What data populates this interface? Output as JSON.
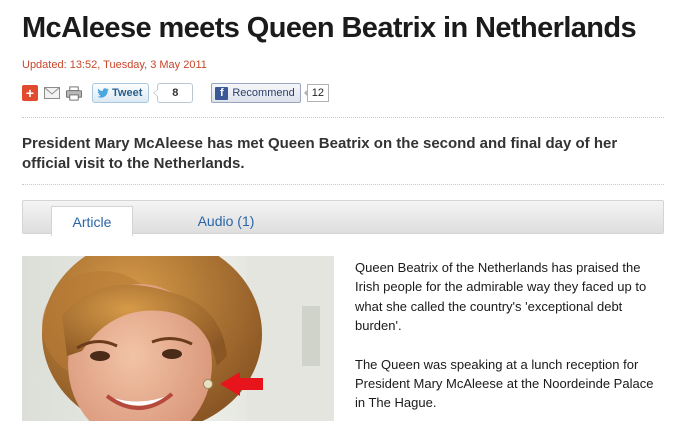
{
  "article": {
    "headline": "McAleese meets Queen Beatrix in Netherlands",
    "updated": "Updated: 13:52, Tuesday, 3 May 2011",
    "standfirst": "President Mary McAleese has met Queen Beatrix on the second and final day of her official visit to the Netherlands.",
    "paragraphs": [
      "Queen Beatrix of the Netherlands has praised the Irish people for the admirable way they faced up to what she called the country's 'exceptional debt burden'.",
      "The Queen was speaking at a lunch reception for President Mary McAleese at the Noordeinde Palace in The Hague."
    ]
  },
  "share": {
    "icons": [
      "add-icon",
      "email-icon",
      "print-icon"
    ],
    "tweet_label": "Tweet",
    "tweet_count": "8",
    "recommend_label": "Recommend",
    "recommend_count": "12"
  },
  "tabs": [
    {
      "label": "Article",
      "active": true
    },
    {
      "label": "Audio (1)",
      "active": false
    }
  ],
  "colors": {
    "updated_text": "#c8462a",
    "link_blue": "#2a65a8",
    "arrow_red": "#e8141c",
    "facebook_blue": "#3b5998"
  }
}
